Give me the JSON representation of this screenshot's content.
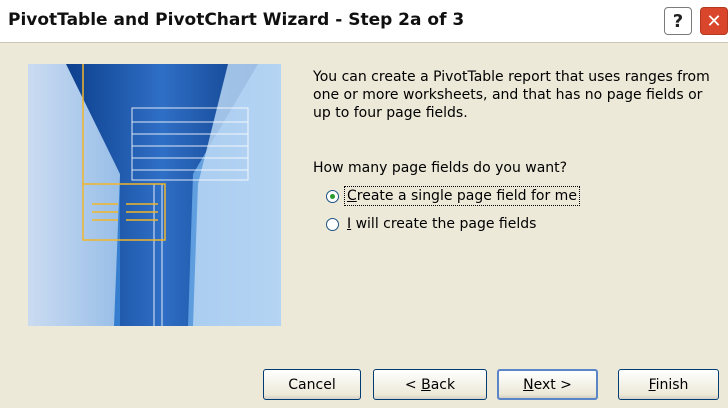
{
  "window": {
    "title": "PivotTable and PivotChart Wizard - Step 2a of 3",
    "help_glyph": "?",
    "close_glyph": "✕"
  },
  "content": {
    "message": "You can create a PivotTable report that uses ranges from one or more worksheets, and that has no page fields or up to four page fields.",
    "question": "How many page fields do you want?",
    "options": [
      {
        "mnemonic": "C",
        "rest": "reate a single page field for me",
        "selected": true
      },
      {
        "mnemonic": "I",
        "rest": " will create the page fields",
        "selected": false
      }
    ]
  },
  "buttons": {
    "cancel": {
      "label": "Cancel"
    },
    "back": {
      "prefix": "< ",
      "mnemonic": "B",
      "rest": "ack"
    },
    "next": {
      "mnemonic": "N",
      "rest": "ext >"
    },
    "finish": {
      "mnemonic": "F",
      "rest": "inish"
    }
  },
  "colors": {
    "dialog_bg": "#ece9d8",
    "close_button": "#d9462c",
    "radio_dot": "#2a9a2a",
    "default_button_border": "#5a86c8"
  }
}
